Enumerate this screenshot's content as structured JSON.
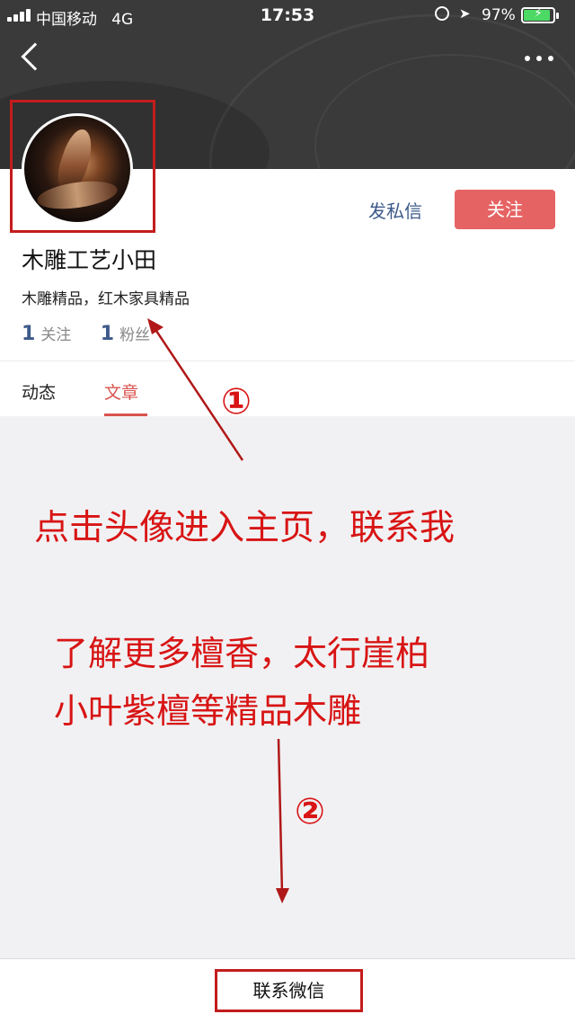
{
  "status_bar": {
    "carrier": "中国移动",
    "network": "4G",
    "time": "17:53",
    "battery_percent": "97%",
    "battery_level": 0.97
  },
  "profile": {
    "name": "木雕工艺小田",
    "bio": "木雕精品，红木家具精品",
    "following_count": "1",
    "following_label": "关注",
    "followers_count": "1",
    "followers_label": "粉丝",
    "message_label": "发私信",
    "follow_label": "关注"
  },
  "tabs": [
    {
      "label": "动态"
    },
    {
      "label": "文章"
    }
  ],
  "annotations": {
    "marker_1": "①",
    "marker_2": "②",
    "line_1": "点击头像进入主页，联系我",
    "line_2": "了解更多檀香，太行崖柏",
    "line_3": "小叶紫檀等精品木雕"
  },
  "bottom": {
    "contact_label": "联系微信"
  },
  "colors": {
    "follow_button": "#e66364",
    "accent_text": "#3d5a8a",
    "active_tab": "#d9534f",
    "annotation_red": "#d81414"
  }
}
